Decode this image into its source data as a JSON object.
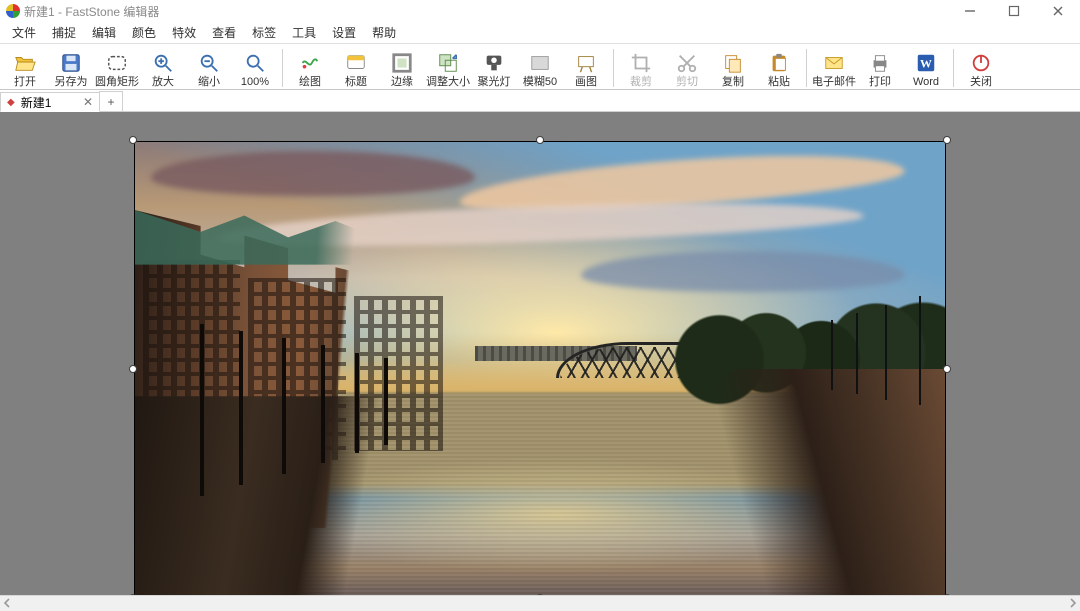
{
  "titlebar": {
    "title": "新建1 - FastStone 编辑器"
  },
  "menu": {
    "items": [
      "文件",
      "捕捉",
      "编辑",
      "颜色",
      "特效",
      "查看",
      "标签",
      "工具",
      "设置",
      "帮助"
    ]
  },
  "toolbar": {
    "groups": [
      [
        {
          "id": "open",
          "label": "打开",
          "icon": "folder-open-icon"
        },
        {
          "id": "saveas",
          "label": "另存为",
          "icon": "save-icon"
        },
        {
          "id": "roundrect",
          "label": "圆角矩形",
          "icon": "round-rect-icon"
        },
        {
          "id": "zoomin",
          "label": "放大",
          "icon": "zoom-in-icon"
        },
        {
          "id": "zoomout",
          "label": "缩小",
          "icon": "zoom-out-icon"
        },
        {
          "id": "zoom100",
          "label": "100%",
          "icon": "zoom-100-icon"
        }
      ],
      [
        {
          "id": "draw",
          "label": "绘图",
          "icon": "draw-icon"
        },
        {
          "id": "caption",
          "label": "标题",
          "icon": "caption-icon"
        },
        {
          "id": "edge",
          "label": "边缘",
          "icon": "edge-icon"
        },
        {
          "id": "resize",
          "label": "调整大小",
          "icon": "resize-icon"
        },
        {
          "id": "spotlight",
          "label": "聚光灯",
          "icon": "spotlight-icon"
        },
        {
          "id": "blur50",
          "label": "模糊50",
          "icon": "blur-icon"
        },
        {
          "id": "canvas",
          "label": "画图",
          "icon": "canvas-icon"
        }
      ],
      [
        {
          "id": "crop",
          "label": "裁剪",
          "icon": "crop-icon",
          "disabled": true
        },
        {
          "id": "cut",
          "label": "剪切",
          "icon": "cut-icon",
          "disabled": true
        },
        {
          "id": "copy",
          "label": "复制",
          "icon": "copy-icon"
        },
        {
          "id": "paste",
          "label": "粘贴",
          "icon": "paste-icon"
        }
      ],
      [
        {
          "id": "email",
          "label": "电子邮件",
          "icon": "email-icon"
        },
        {
          "id": "print",
          "label": "打印",
          "icon": "print-icon"
        },
        {
          "id": "word",
          "label": "Word",
          "icon": "word-icon"
        }
      ],
      [
        {
          "id": "close",
          "label": "关闭",
          "icon": "power-icon"
        }
      ]
    ]
  },
  "tabs": {
    "items": [
      {
        "label": "新建1",
        "modified": true
      }
    ],
    "new_tab": "+"
  }
}
